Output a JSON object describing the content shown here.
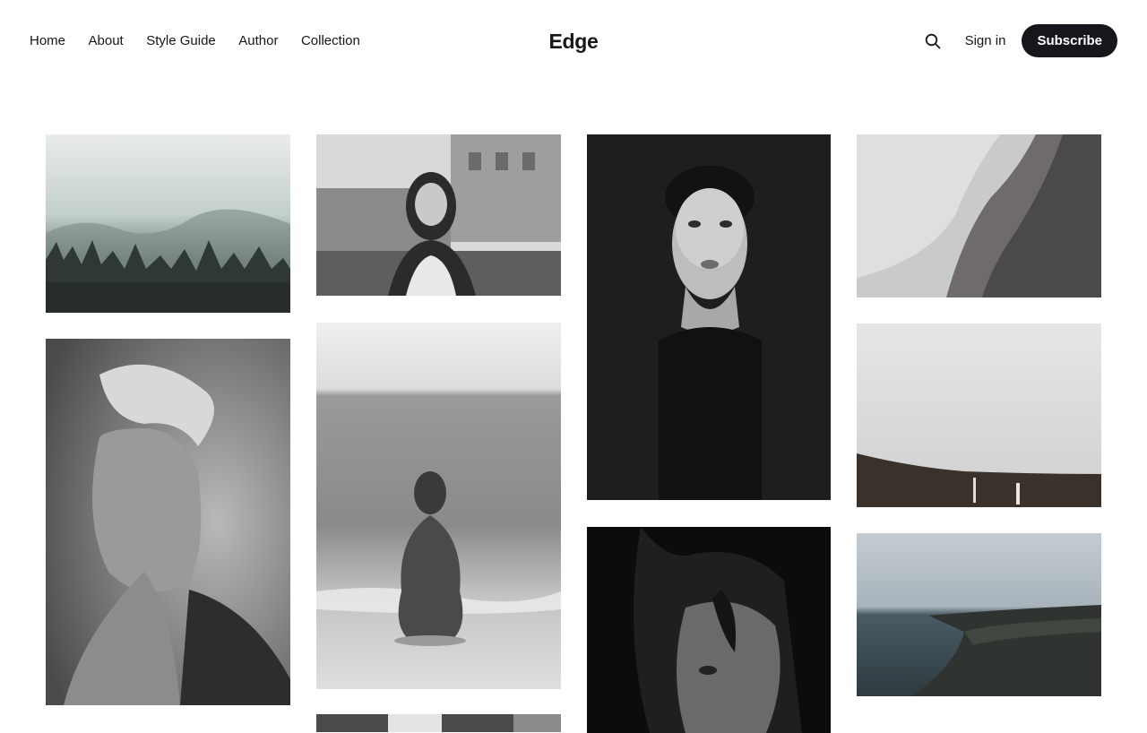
{
  "header": {
    "logo": "Edge",
    "nav": [
      {
        "label": "Home",
        "name": "nav-home"
      },
      {
        "label": "About",
        "name": "nav-about"
      },
      {
        "label": "Style Guide",
        "name": "nav-style-guide"
      },
      {
        "label": "Author",
        "name": "nav-author"
      },
      {
        "label": "Collection",
        "name": "nav-collection"
      }
    ],
    "search_icon": "search-icon",
    "signin_label": "Sign in",
    "subscribe_label": "Subscribe"
  },
  "colors": {
    "text": "#15171a",
    "button_bg": "#15171a",
    "button_text": "#ffffff",
    "background": "#ffffff"
  },
  "gallery": {
    "posts": [
      {
        "name": "post-misty-forest",
        "subject": "misty pine forest"
      },
      {
        "name": "post-girl-street",
        "subject": "woman on city street"
      },
      {
        "name": "post-portrait-dark",
        "subject": "portrait on dark background"
      },
      {
        "name": "post-foggy-mountain",
        "subject": "foggy mountainside"
      },
      {
        "name": "post-short-hair-portrait",
        "subject": "short hair portrait"
      },
      {
        "name": "post-beach-woman",
        "subject": "woman sitting on beach"
      },
      {
        "name": "post-foggy-cliff",
        "subject": "foggy cliff with waterfalls"
      },
      {
        "name": "post-smiling-shadow",
        "subject": "smiling face in shadow"
      },
      {
        "name": "post-coastline",
        "subject": "coastline under overcast sky"
      },
      {
        "name": "post-partial-bottom",
        "subject": "partially visible image"
      }
    ]
  }
}
